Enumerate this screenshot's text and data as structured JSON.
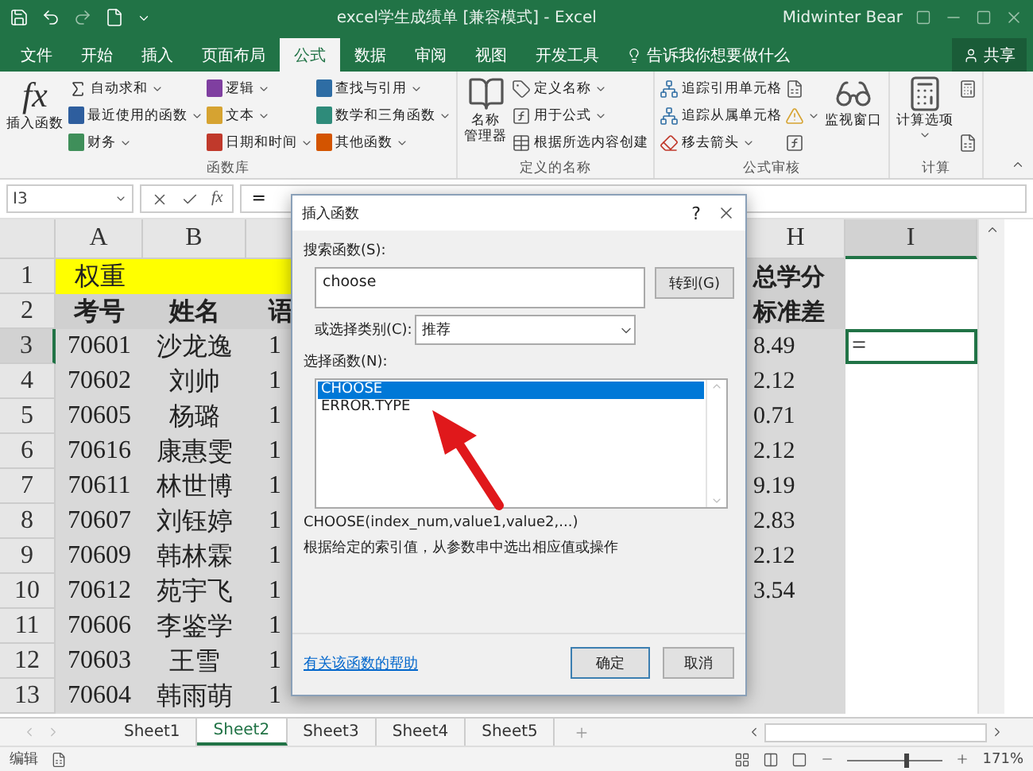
{
  "title_bar": {
    "title": "excel学生成绩单  [兼容模式]  -  Excel",
    "user": "Midwinter Bear"
  },
  "ribbon_tabs": [
    {
      "label": "文件",
      "selected": false
    },
    {
      "label": "开始",
      "selected": false
    },
    {
      "label": "插入",
      "selected": false
    },
    {
      "label": "页面布局",
      "selected": false
    },
    {
      "label": "公式",
      "selected": true
    },
    {
      "label": "数据",
      "selected": false
    },
    {
      "label": "审阅",
      "selected": false
    },
    {
      "label": "视图",
      "selected": false
    },
    {
      "label": "开发工具",
      "selected": false
    }
  ],
  "tell_me": {
    "placeholder": "告诉我你想要做什么"
  },
  "share_button": {
    "label": "共享"
  },
  "ribbon_groups": [
    {
      "label": "函数库",
      "parts": [
        {
          "kind": "big",
          "symbol": "fx",
          "label_lines": [
            "插入函数"
          ],
          "dropdown": false
        },
        {
          "kind": "column",
          "items": [
            {
              "label": "自动求和",
              "dropdown": true
            },
            {
              "color": "#2e5e9e",
              "label": "最近使用的函数",
              "dropdown": true
            },
            {
              "color": "#3f8f5a",
              "label": "财务",
              "dropdown": true
            }
          ]
        },
        {
          "kind": "column",
          "items": [
            {
              "color": "#7f3fa0",
              "label": "逻辑",
              "dropdown": true
            },
            {
              "color": "#d6a331",
              "label": "文本",
              "dropdown": true
            },
            {
              "color": "#c0392b",
              "label": "日期和时间",
              "dropdown": true
            }
          ]
        },
        {
          "kind": "column",
          "items": [
            {
              "color": "#2e6da4",
              "label": "查找与引用",
              "dropdown": true
            },
            {
              "color": "#2e8b7a",
              "label": "数学和三角函数",
              "dropdown": true
            },
            {
              "color": "#d35400",
              "label": "其他函数",
              "dropdown": true
            }
          ]
        }
      ]
    },
    {
      "label": "定义的名称",
      "parts": [
        {
          "kind": "big",
          "label_lines": [
            "名称",
            "管理器"
          ],
          "dropdown": false
        },
        {
          "kind": "column",
          "items": [
            {
              "label": "定义名称",
              "dropdown": true
            },
            {
              "label": "用于公式",
              "dropdown": true
            },
            {
              "label": "根据所选内容创建",
              "dropdown": false
            }
          ]
        }
      ]
    },
    {
      "label": "公式审核",
      "parts": [
        {
          "kind": "column",
          "items": [
            {
              "label": "追踪引用单元格",
              "dropdown": false
            },
            {
              "label": "追踪从属单元格",
              "dropdown": false
            },
            {
              "label": "移去箭头",
              "dropdown": true
            }
          ]
        },
        {
          "kind": "column",
          "items": [
            {
              "dropdown": false
            },
            {
              "dropdown": true
            },
            {
              "dropdown": false
            }
          ]
        },
        {
          "kind": "big",
          "label_lines": [
            "监视窗口"
          ],
          "dropdown": false
        }
      ]
    },
    {
      "label": "计算",
      "parts": [
        {
          "kind": "big",
          "label_lines": [
            "计算选项"
          ],
          "dropdown": true
        },
        {
          "kind": "column",
          "items": [
            {
              "dropdown": false
            },
            {
              "dropdown": false
            }
          ]
        }
      ]
    }
  ],
  "formula_bar": {
    "name_box": "I3",
    "fx_button": "fx",
    "formula": "="
  },
  "column_headers": [
    {
      "label": "A",
      "selected": false
    },
    {
      "label": "B",
      "selected": false
    },
    {
      "label": "H",
      "selected": false
    },
    {
      "label": "I",
      "selected": true
    }
  ],
  "rows": [
    {
      "number": "1",
      "kind": "weight",
      "a": "权重",
      "b": "",
      "c": "",
      "h": "总学分",
      "i": "",
      "selected": false
    },
    {
      "number": "2",
      "kind": "header",
      "a": "考号",
      "b": "姓名",
      "c": "语",
      "h": "标准差",
      "i": "",
      "selected": false
    },
    {
      "number": "3",
      "kind": "data",
      "a": "70601",
      "b": "沙龙逸",
      "c": "1",
      "h": "8.49",
      "i": "=",
      "selected": true
    },
    {
      "number": "4",
      "kind": "data",
      "a": "70602",
      "b": "刘帅",
      "c": "1",
      "h": "2.12",
      "i": "",
      "selected": false
    },
    {
      "number": "5",
      "kind": "data",
      "a": "70605",
      "b": "杨璐",
      "c": "1",
      "h": "0.71",
      "i": "",
      "selected": false
    },
    {
      "number": "6",
      "kind": "data",
      "a": "70616",
      "b": "康惠雯",
      "c": "1",
      "h": "2.12",
      "i": "",
      "selected": false
    },
    {
      "number": "7",
      "kind": "data",
      "a": "70611",
      "b": "林世博",
      "c": "1",
      "h": "9.19",
      "i": "",
      "selected": false
    },
    {
      "number": "8",
      "kind": "data",
      "a": "70607",
      "b": "刘钰婷",
      "c": "1",
      "h": "2.83",
      "i": "",
      "selected": false
    },
    {
      "number": "9",
      "kind": "data",
      "a": "70609",
      "b": "韩林霖",
      "c": "1",
      "h": "2.12",
      "i": "",
      "selected": false
    },
    {
      "number": "10",
      "kind": "data",
      "a": "70612",
      "b": "苑宇飞",
      "c": "1",
      "h": "3.54",
      "i": "",
      "selected": false
    },
    {
      "number": "11",
      "kind": "data",
      "a": "70606",
      "b": "李鉴学",
      "c": "1",
      "h": "",
      "i": "",
      "selected": false
    },
    {
      "number": "12",
      "kind": "data",
      "a": "70603",
      "b": "王雪",
      "c": "1",
      "h": "",
      "i": "",
      "selected": false
    },
    {
      "number": "13",
      "kind": "data",
      "a": "70604",
      "b": "韩雨萌",
      "c": "1",
      "h": "",
      "i": "",
      "selected": false
    }
  ],
  "dialog": {
    "title": "插入函数",
    "help_button": "?",
    "search_label": "搜索函数(S):",
    "search_value": "choose",
    "go_button": "转到(G)",
    "category_label": "或选择类别(C):",
    "category_value": "推荐",
    "list_label": "选择函数(N):",
    "functions": [
      {
        "label": "CHOOSE",
        "selected": true
      },
      {
        "label": "ERROR.TYPE",
        "selected": false
      }
    ],
    "syntax": "CHOOSE(index_num,value1,value2,...)",
    "description": "根据给定的索引值，从参数串中选出相应值或操作",
    "help_link": "有关该函数的帮助",
    "ok_button": "确定",
    "cancel_button": "取消"
  },
  "sheet_tabs": [
    {
      "label": "Sheet1",
      "selected": false
    },
    {
      "label": "Sheet2",
      "selected": true
    },
    {
      "label": "Sheet3",
      "selected": false
    },
    {
      "label": "Sheet4",
      "selected": false
    },
    {
      "label": "Sheet5",
      "selected": false
    }
  ],
  "status_bar": {
    "mode": "编辑",
    "zoom_slider": {
      "level": 0.62
    },
    "zoom": "171%"
  }
}
